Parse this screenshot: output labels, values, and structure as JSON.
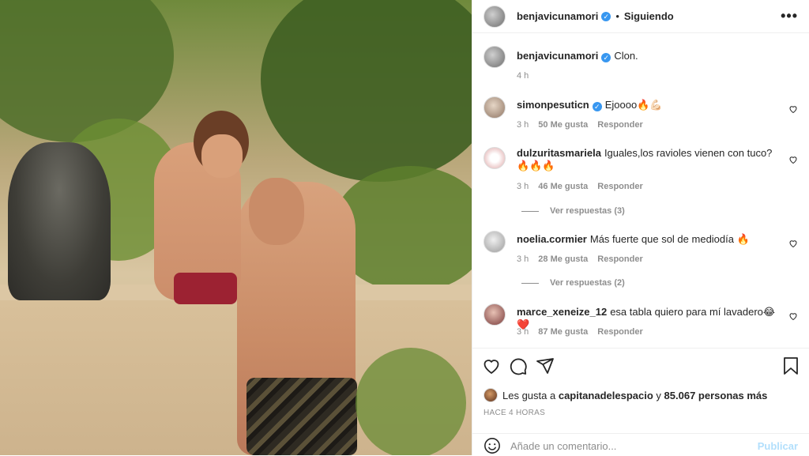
{
  "header": {
    "username": "benjavicunamori",
    "verified_mark": "✓",
    "separator": "•",
    "follow_status": "Siguiendo",
    "more": "•••"
  },
  "caption": {
    "username": "benjavicunamori",
    "text": "Clon.",
    "time": "4 h"
  },
  "comments": [
    {
      "username": "simonpesuticn",
      "verified": true,
      "text": "Ejoooo🔥💪🏻",
      "time": "3 h",
      "likes": "50 Me gusta",
      "reply": "Responder"
    },
    {
      "username": "dulzuritasmariela",
      "verified": false,
      "text": "Iguales,los ravioles vienen con tuco? 🔥🔥🔥",
      "time": "3 h",
      "likes": "46 Me gusta",
      "reply": "Responder",
      "view_replies": "Ver respuestas (3)"
    },
    {
      "username": "noelia.cormier",
      "verified": false,
      "text": "Más fuerte que sol de mediodía 🔥",
      "time": "3 h",
      "likes": "28 Me gusta",
      "reply": "Responder",
      "view_replies": "Ver respuestas (2)"
    },
    {
      "username": "marce_xeneize_12",
      "verified": false,
      "text": "esa tabla quiero para mí lavadero😂❤️",
      "time": "3 h",
      "likes": "87 Me gusta",
      "reply": "Responder"
    }
  ],
  "likes_line": {
    "prefix": "Les gusta a",
    "user": "capitanadelespacio",
    "and": "y",
    "others": "85.067 personas más"
  },
  "post_time": "HACE 4 HORAS",
  "comment_box": {
    "placeholder": "Añade un comentario...",
    "publish": "Publicar"
  },
  "icons": [
    "like-heart-icon",
    "comment-icon",
    "share-icon",
    "save-bookmark-icon",
    "emoji-icon"
  ],
  "colors": {
    "verified": "#3897f0",
    "publish_disabled": "#b2dffc",
    "meta": "#8e8e8e"
  }
}
